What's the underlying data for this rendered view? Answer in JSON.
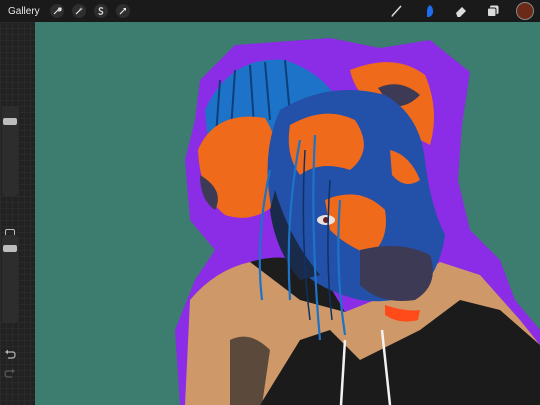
{
  "toolbar": {
    "gallery_label": "Gallery",
    "left_buttons": [
      "wrench-icon",
      "magic-wand-icon",
      "selection-s-icon",
      "transform-arrow-icon"
    ],
    "right_tools": [
      "brush-icon",
      "smudge-icon",
      "eraser-icon",
      "layers-icon"
    ],
    "active_tool": "smudge-icon",
    "current_color": "#6b2a17"
  },
  "sidebar": {
    "brush_size_level": 0.92,
    "opacity_level": 0.88
  },
  "canvas": {
    "background_color": "#3d7d6f",
    "outline_color": "#8b2ce6",
    "mask_blue": "#2350a8",
    "mask_orange": "#f06a1c",
    "hair_color": "#1c73c7",
    "skin_color": "#cf9868"
  }
}
